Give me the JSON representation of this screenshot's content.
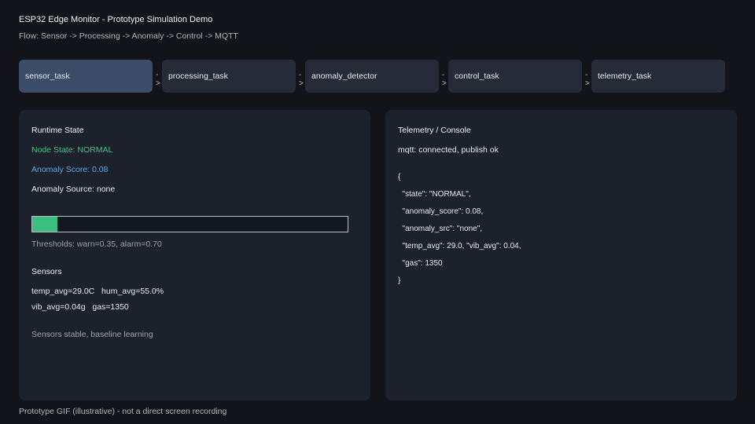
{
  "header": {
    "title": "ESP32 Edge Monitor - Prototype Simulation Demo",
    "flow": "Flow: Sensor -> Processing -> Anomaly -> Control -> MQTT"
  },
  "pipeline": {
    "arrow": "->",
    "stages": [
      {
        "label": "sensor_task",
        "active": true
      },
      {
        "label": "processing_task",
        "active": false
      },
      {
        "label": "anomaly_detector",
        "active": false
      },
      {
        "label": "control_task",
        "active": false
      },
      {
        "label": "telemetry_task",
        "active": false
      }
    ]
  },
  "runtime": {
    "heading": "Runtime State",
    "node_state": "Node State: NORMAL",
    "anomaly_score": "Anomaly Score: 0.08",
    "anomaly_source": "Anomaly Source: none",
    "score_value": 0.08,
    "thresholds": "Thresholds: warn=0.35, alarm=0.70",
    "sensors_heading": "Sensors",
    "sensor_line1": "temp_avg=29.0C   hum_avg=55.0%",
    "sensor_line2": "vib_avg=0.04g   gas=1350",
    "status": "Sensors stable, baseline learning"
  },
  "telemetry": {
    "heading": "Telemetry / Console",
    "status": "mqtt: connected, publish ok",
    "json_lines": [
      "{",
      "  \"state\": \"NORMAL\",",
      "  \"anomaly_score\": 0.08,",
      "  \"anomaly_src\": \"none\",",
      "  \"temp_avg\": 29.0, \"vib_avg\": 0.04,",
      "  \"gas\": 1350",
      "}"
    ]
  },
  "footer": {
    "note": "Prototype GIF (illustrative) - not a direct screen recording"
  },
  "colors": {
    "background": "#121419",
    "panel": "#1c212b",
    "stage": "#262b37",
    "stage_active": "#3c4b68",
    "normal_green": "#46c183",
    "score_blue": "#5fa8e6"
  }
}
